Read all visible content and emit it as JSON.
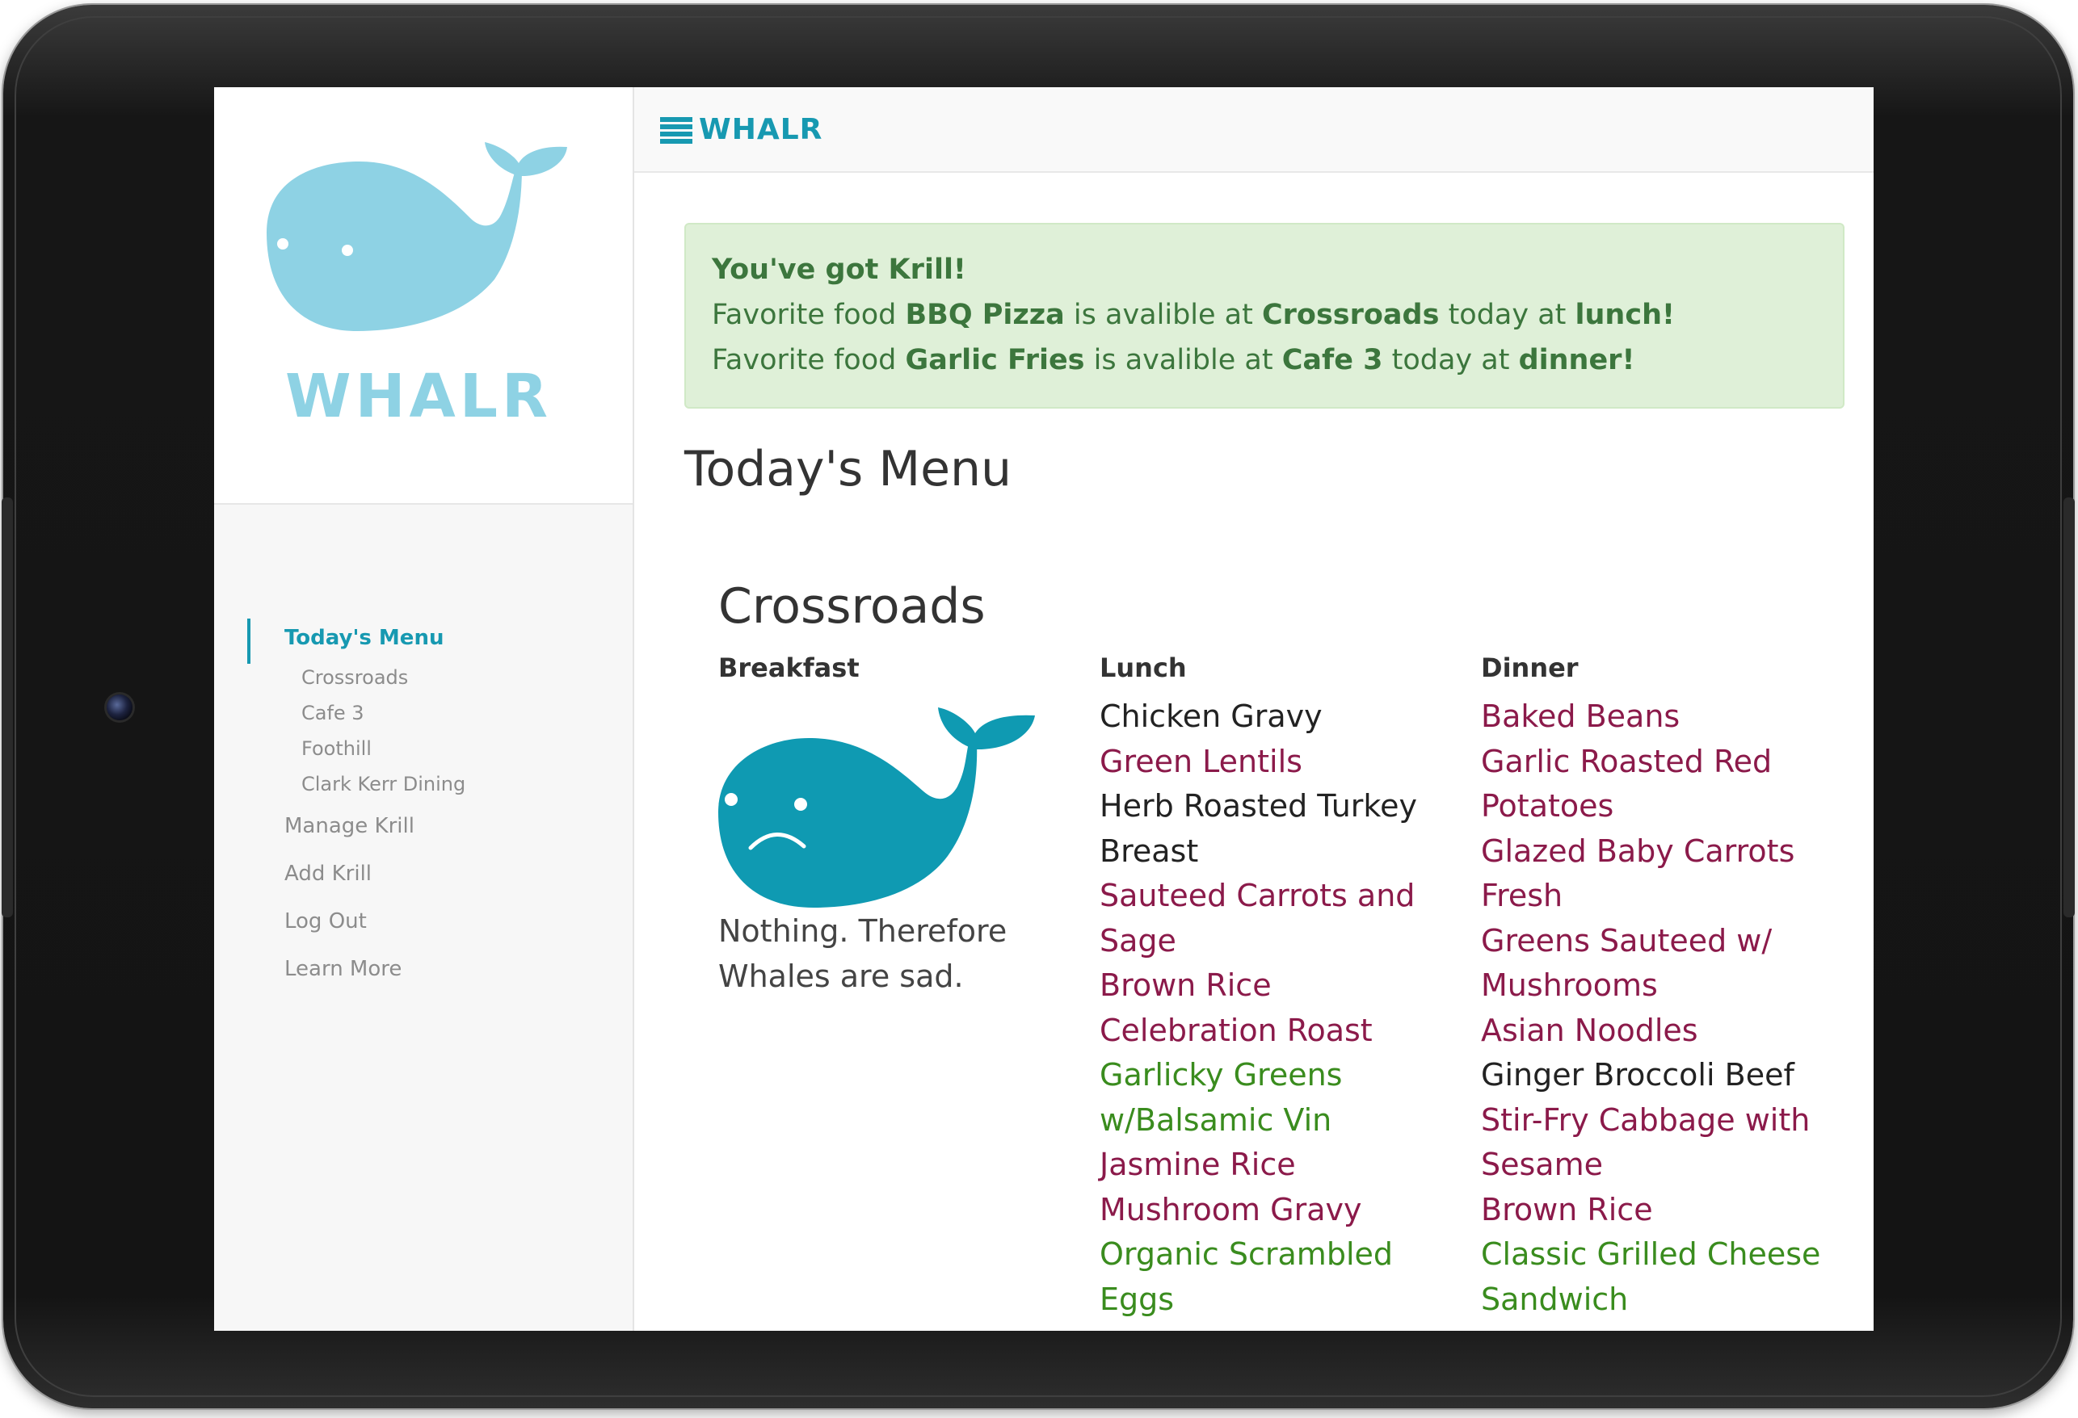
{
  "app": {
    "brand": "WHALR",
    "logo_text": "WHALR",
    "colors": {
      "accent": "#1799b1",
      "logo_whale": "#8ed2e4",
      "sad_whale": "#0f9ab2",
      "alert_bg": "#dff0d8",
      "alert_text": "#3c763d",
      "unfavorite_item": "#8b1a4a",
      "favorite_item": "#3a8c1e"
    }
  },
  "sidebar": {
    "items": [
      {
        "label": "Today's Menu",
        "active": true
      },
      {
        "label": "Crossroads"
      },
      {
        "label": "Cafe 3"
      },
      {
        "label": "Foothill"
      },
      {
        "label": "Clark Kerr Dining"
      },
      {
        "label": "Manage Krill"
      },
      {
        "label": "Add Krill"
      },
      {
        "label": "Log Out"
      },
      {
        "label": "Learn More"
      }
    ]
  },
  "header": {
    "menu_icon": "hamburger-icon",
    "brand": "WHALR"
  },
  "alert": {
    "title": "You've got Krill!",
    "lines": [
      {
        "prefix": "Favorite food ",
        "food": "BBQ Pizza",
        "mid": " is avalible at ",
        "place": "Crossroads",
        "mid2": " today at ",
        "meal": "lunch!"
      },
      {
        "prefix": "Favorite food ",
        "food": "Garlic Fries",
        "mid": " is avalible at ",
        "place": "Cafe 3",
        "mid2": " today at ",
        "meal": "dinner!"
      }
    ]
  },
  "main": {
    "page_title": "Today's Menu",
    "hall": {
      "name": "Crossroads",
      "breakfast": {
        "heading": "Breakfast",
        "empty_icon": "sad-whale-icon",
        "empty_text": "Nothing. Therefore Whales are sad."
      },
      "lunch": {
        "heading": "Lunch",
        "items": [
          {
            "text": "Chicken Gravy",
            "type": "plain"
          },
          {
            "text": "Green Lentils",
            "type": "unfavorite"
          },
          {
            "text": "Herb Roasted Turkey Breast",
            "type": "plain"
          },
          {
            "text": "Sauteed Carrots and Sage",
            "type": "unfavorite"
          },
          {
            "text": "Brown Rice",
            "type": "unfavorite"
          },
          {
            "text": "Celebration Roast",
            "type": "unfavorite"
          },
          {
            "text": "Garlicky Greens w/Balsamic Vin",
            "type": "favorite"
          },
          {
            "text": "Jasmine Rice",
            "type": "unfavorite"
          },
          {
            "text": "Mushroom Gravy",
            "type": "unfavorite"
          },
          {
            "text": "Organic Scrambled Eggs",
            "type": "favorite"
          }
        ]
      },
      "dinner": {
        "heading": "Dinner",
        "items": [
          {
            "text": "Baked Beans",
            "type": "unfavorite"
          },
          {
            "text": "Garlic Roasted Red Potatoes",
            "type": "unfavorite"
          },
          {
            "text": "Glazed Baby Carrots Fresh",
            "type": "unfavorite"
          },
          {
            "text": "Greens Sauteed w/ Mushrooms",
            "type": "unfavorite"
          },
          {
            "text": "Asian Noodles",
            "type": "unfavorite"
          },
          {
            "text": "Ginger Broccoli Beef",
            "type": "plain"
          },
          {
            "text": "Stir-Fry Cabbage with Sesame",
            "type": "unfavorite"
          },
          {
            "text": "Brown Rice",
            "type": "unfavorite"
          },
          {
            "text": "Classic Grilled Cheese Sandwich",
            "type": "favorite"
          }
        ]
      }
    }
  }
}
